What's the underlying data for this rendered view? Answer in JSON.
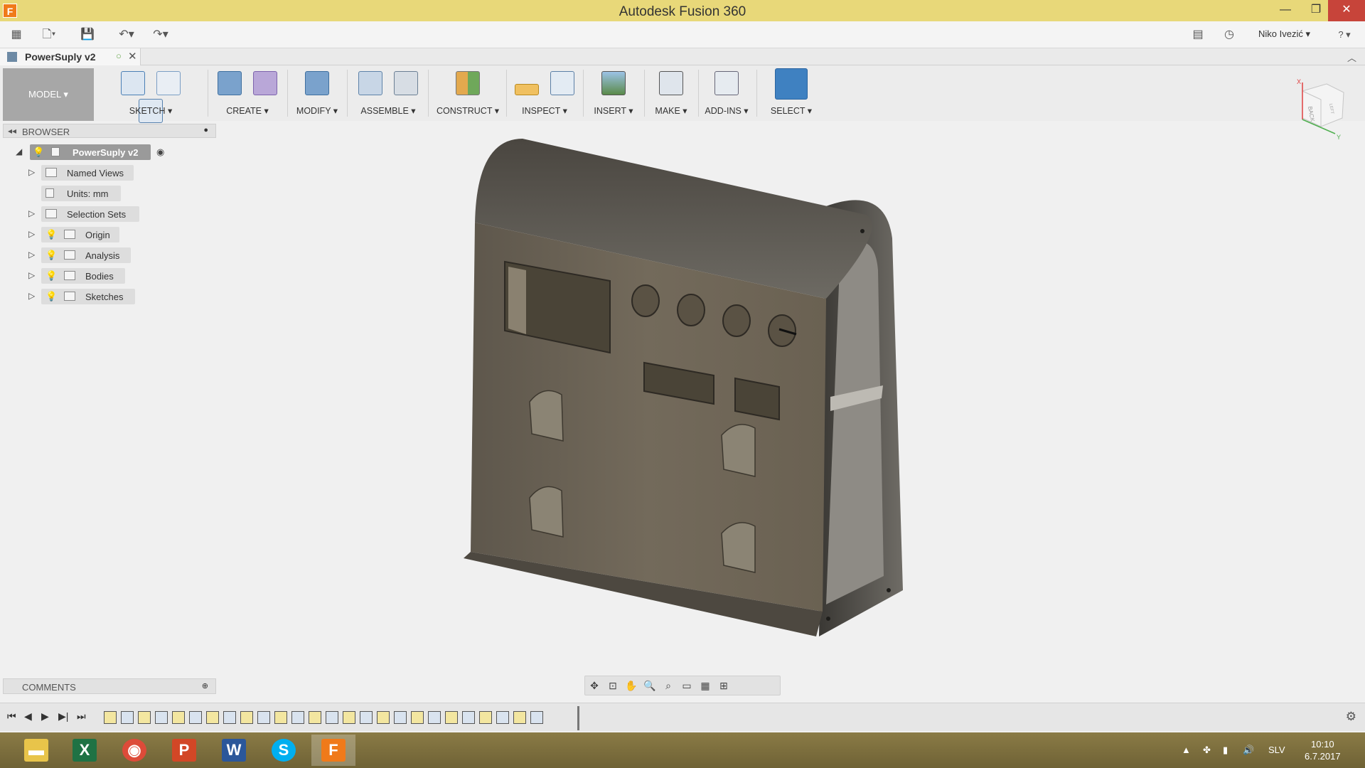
{
  "window": {
    "title": "Autodesk Fusion 360",
    "minimize": "—",
    "maximize": "❐",
    "close": "✕"
  },
  "quick_access": {
    "user": "Niko Ivezić ▾",
    "help": "? ▾"
  },
  "document_tab": {
    "name": "PowerSuply v2"
  },
  "toolbar": {
    "workspace": "MODEL ▾",
    "groups": [
      {
        "label": "SKETCH ▾"
      },
      {
        "label": "CREATE ▾"
      },
      {
        "label": "MODIFY ▾"
      },
      {
        "label": "ASSEMBLE ▾"
      },
      {
        "label": "CONSTRUCT ▾"
      },
      {
        "label": "INSPECT ▾"
      },
      {
        "label": "INSERT ▾"
      },
      {
        "label": "MAKE ▾"
      },
      {
        "label": "ADD-INS ▾"
      },
      {
        "label": "SELECT ▾"
      }
    ]
  },
  "browser": {
    "title": "BROWSER",
    "root": "PowerSuply v2",
    "items": [
      {
        "label": "Named Views"
      },
      {
        "label": "Units: mm"
      },
      {
        "label": "Selection Sets"
      },
      {
        "label": "Origin"
      },
      {
        "label": "Analysis"
      },
      {
        "label": "Bodies"
      },
      {
        "label": "Sketches"
      }
    ]
  },
  "comments": {
    "title": "COMMENTS"
  },
  "viewcube": {
    "face": "BACK",
    "side": "LEFT",
    "axis_x": "X",
    "axis_y": "Y"
  },
  "taskbar": {
    "language": "SLV",
    "time": "10:10",
    "date": "6.7.2017"
  },
  "colors": {
    "titlebar": "#e8d879",
    "model_body": "#6b6254",
    "model_top": "#55514a",
    "select_accent": "#3f81c1"
  }
}
